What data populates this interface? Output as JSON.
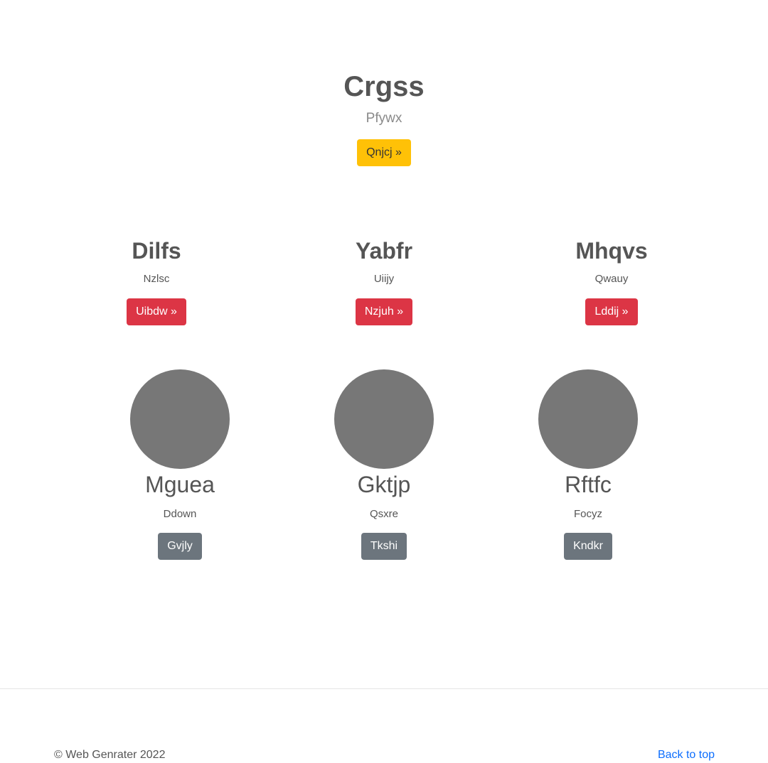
{
  "hero": {
    "title": "Crgss",
    "subtitle": "Pfywx",
    "button_label": "Qnjcj »"
  },
  "features": [
    {
      "title": "Dilfs",
      "subtitle": "Nzlsc",
      "button_label": "Uibdw »"
    },
    {
      "title": "Yabfr",
      "subtitle": "Uiijy",
      "button_label": "Nzjuh »"
    },
    {
      "title": "Mhqvs",
      "subtitle": "Qwauy",
      "button_label": "Lddij »"
    }
  ],
  "profiles": [
    {
      "name": "Mguea",
      "subtitle": "Ddown",
      "button_label": "Gvjly"
    },
    {
      "name": "Gktjp",
      "subtitle": "Qsxre",
      "button_label": "Tkshi"
    },
    {
      "name": "Rftfc",
      "subtitle": "Focyz",
      "button_label": "Kndkr"
    }
  ],
  "footer": {
    "copyright": "© Web Genrater 2022",
    "back_to_top": "Back to top"
  },
  "colors": {
    "hero_button": "#ffc107",
    "feature_button": "#dc3545",
    "profile_button": "#6c757d",
    "avatar": "#777777",
    "link": "#0d6efd"
  }
}
